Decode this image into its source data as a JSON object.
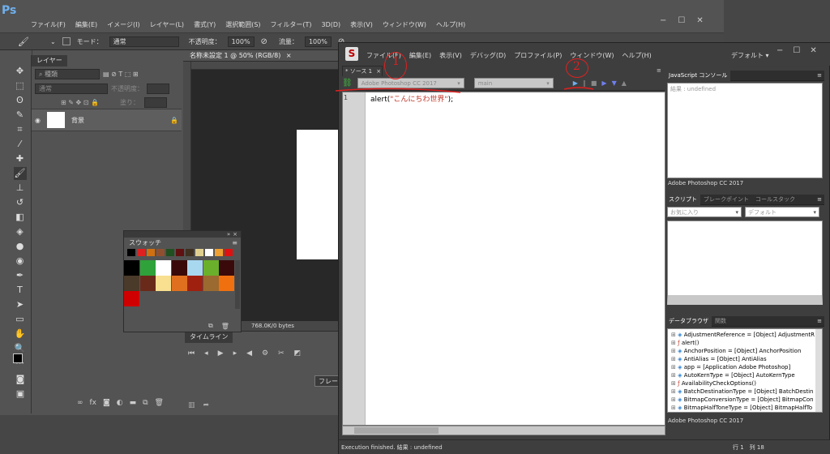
{
  "photoshop": {
    "logo": "Ps",
    "menus": [
      "ファイル(F)",
      "編集(E)",
      "イメージ(I)",
      "レイヤー(L)",
      "書式(Y)",
      "選択範囲(S)",
      "フィルター(T)",
      "3D(D)",
      "表示(V)",
      "ウィンドウ(W)",
      "ヘルプ(H)"
    ],
    "options": {
      "mode_label": "モード：",
      "mode_value": "通常",
      "opacity_label": "不透明度：",
      "opacity_value": "100%",
      "flow_label": "流量：",
      "flow_value": "100%"
    },
    "layers_panel": {
      "tab": "レイヤー",
      "search_placeholder": "種類",
      "blend_mode": "通常",
      "opacity_label": "不透明度：",
      "fill_label": "塗り：",
      "layer_name": "背景"
    },
    "document_tab": "名称未設定 1 @ 50% (RGB/8)",
    "document_close": "×",
    "status_text": "768.0K/0 bytes",
    "timeline_tab": "タイムライン",
    "timeline_button": "フレー",
    "swatches_tab": "スウォッチ",
    "swatch_row_small": [
      "#000000",
      "#e02020",
      "#d07010",
      "#905030",
      "#205020",
      "#601010",
      "#403020",
      "#e0d090",
      "#ffffff",
      "#f0a030",
      "#e01010"
    ],
    "swatch_grid": [
      [
        "#000000",
        "#2fa23a",
        "#ffffff",
        "#3a0a0a",
        "#a8d8f0",
        "#6ab02a",
        "#3a0a0a"
      ],
      [
        "#4a3a2a",
        "#6a2a1a",
        "#f8e090",
        "#e07020",
        "#a02010",
        "#9a6a30",
        "#f07010"
      ],
      [
        "#d00000"
      ]
    ]
  },
  "estk": {
    "logo": "S",
    "menus": [
      "ファイル(F)",
      "編集(E)",
      "表示(V)",
      "デバッグ(D)",
      "プロファイル(P)",
      "ウィンドウ(W)",
      "ヘルプ(H)"
    ],
    "workspace": "デフォルト",
    "source_tab": "* ソース 1",
    "source_tab_close": "×",
    "target_app": "Adobe Photoshop CC 2017",
    "target_engine": "main",
    "line_number": "1",
    "code_prefix": "alert(",
    "code_string": "\"こんにちわ世界\"",
    "code_suffix": ");",
    "status_left": "Execution finished. 結果 : undefined",
    "status_right": "行 1　列 18",
    "console": {
      "tab": "JavaScript コンソール",
      "output": "結果 : undefined",
      "footer": "Adobe Photoshop CC 2017"
    },
    "scripts": {
      "tabs": [
        "スクリプト",
        "ブレークポイント",
        "コールスタック"
      ],
      "favorites": "お気に入り",
      "default": "デフォルト"
    },
    "databrowser": {
      "tabs": [
        "データブラウザ",
        "関数"
      ],
      "items": [
        "AdjustmentReference = [Object] AdjustmentR",
        "alert()",
        "AnchorPosition = [Object] AnchorPosition",
        "AntiAlias = [Object] AntiAlias",
        "app = [Application Adobe Photoshop]",
        "AutoKernType = [Object] AutoKernType",
        "AvailabilityCheckOptions()",
        "BatchDestinationType = [Object] BatchDestin",
        "BitmapConversionType = [Object] BitmapCon",
        "BitmapHalfToneType = [Object] BitmapHalfTo"
      ],
      "footer": "Adobe Photoshop CC 2017"
    }
  },
  "annotations": {
    "one": "1",
    "two": "2"
  }
}
